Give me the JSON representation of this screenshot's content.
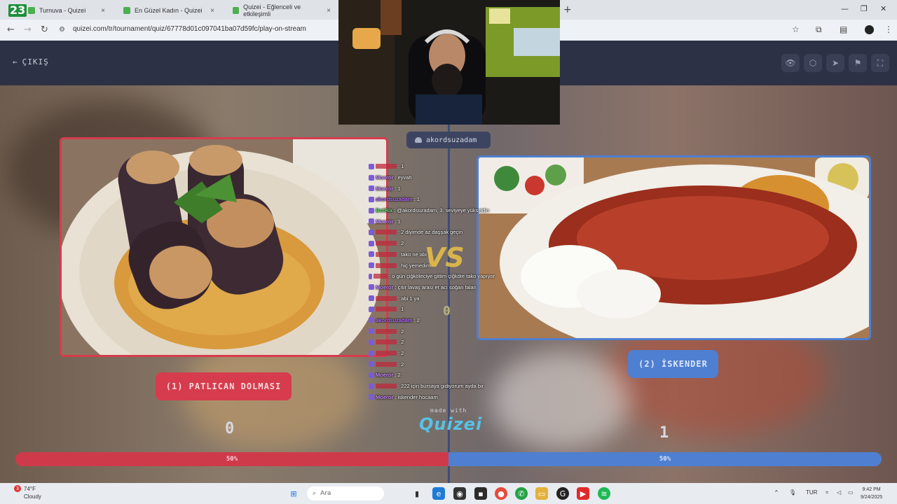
{
  "browser": {
    "tabs": [
      {
        "label": "Turnuva - Quizei"
      },
      {
        "label": "En Güzel Kadın - Quizei"
      },
      {
        "label": "Quizei - Eğlenceli ve etkileşimli"
      }
    ],
    "tab_close_icon": "×",
    "overlay_logo": "23",
    "new_tab_icon": "+",
    "url": "quizei.com/tr/tournament/quiz/67778d01c097041ba07d59fc/play-on-stream"
  },
  "app": {
    "exit_label": "ÇIKIŞ",
    "username": "akordsuzadam",
    "vs_label": "VS",
    "middle_score": "0",
    "made_with": "made with",
    "brand": "Quizei"
  },
  "options": {
    "left": {
      "label": "(1) PATLICAN DOLMASI",
      "score": "0",
      "percent": "50%"
    },
    "right": {
      "label": "(2) İSKENDER",
      "score": "1",
      "percent": "50%"
    }
  },
  "chat": [
    {
      "user": "",
      "msg": ": 1"
    },
    {
      "user": "Moeror",
      "msg": ": eyvah"
    },
    {
      "user": "Moeror",
      "msg": ": 1"
    },
    {
      "user": "akordsuzadam",
      "msg": ": 1"
    },
    {
      "user": "BotRix",
      "msg": ": @akordsuzadam, 3. seviyeye yükseldin"
    },
    {
      "user": "Moeror",
      "msg": ": 1"
    },
    {
      "user": "",
      "msg": ": 2 diyimde az daşşak geçin"
    },
    {
      "user": "",
      "msg": ": 2"
    },
    {
      "user": "",
      "msg": ": tako ne abi"
    },
    {
      "user": "",
      "msg": ": hiç yemedim"
    },
    {
      "user": "",
      "msg": ": o gün çiğköteciye gittim çiğköte tako yapıyor"
    },
    {
      "user": "Moeror",
      "msg": ": çıtır lavaş arası et acı soğan falan"
    },
    {
      "user": "",
      "msg": ": abi 1 ya"
    },
    {
      "user": "",
      "msg": ": 1"
    },
    {
      "user": "akordsuzadam",
      "msg": ": 2"
    },
    {
      "user": "",
      "msg": ": 2"
    },
    {
      "user": "",
      "msg": ": 2"
    },
    {
      "user": "",
      "msg": ": 2"
    },
    {
      "user": "",
      "msg": ": 2"
    },
    {
      "user": "Moeror",
      "msg": ": 2"
    },
    {
      "user": "",
      "msg": ": 222 için bursaya gidiyorum ayda bir"
    },
    {
      "user": "Moeror",
      "msg": ": iskender hocaam"
    }
  ],
  "taskbar": {
    "notification_count": "3",
    "temperature": "74°F",
    "weather": "Cloudy",
    "search_placeholder": "Ara",
    "language": "TUR",
    "time": "9:42 PM",
    "date": "9/24/2025"
  },
  "colors": {
    "red": "#d63c4d",
    "blue": "#4f7fd0",
    "header": "#2c3145"
  }
}
